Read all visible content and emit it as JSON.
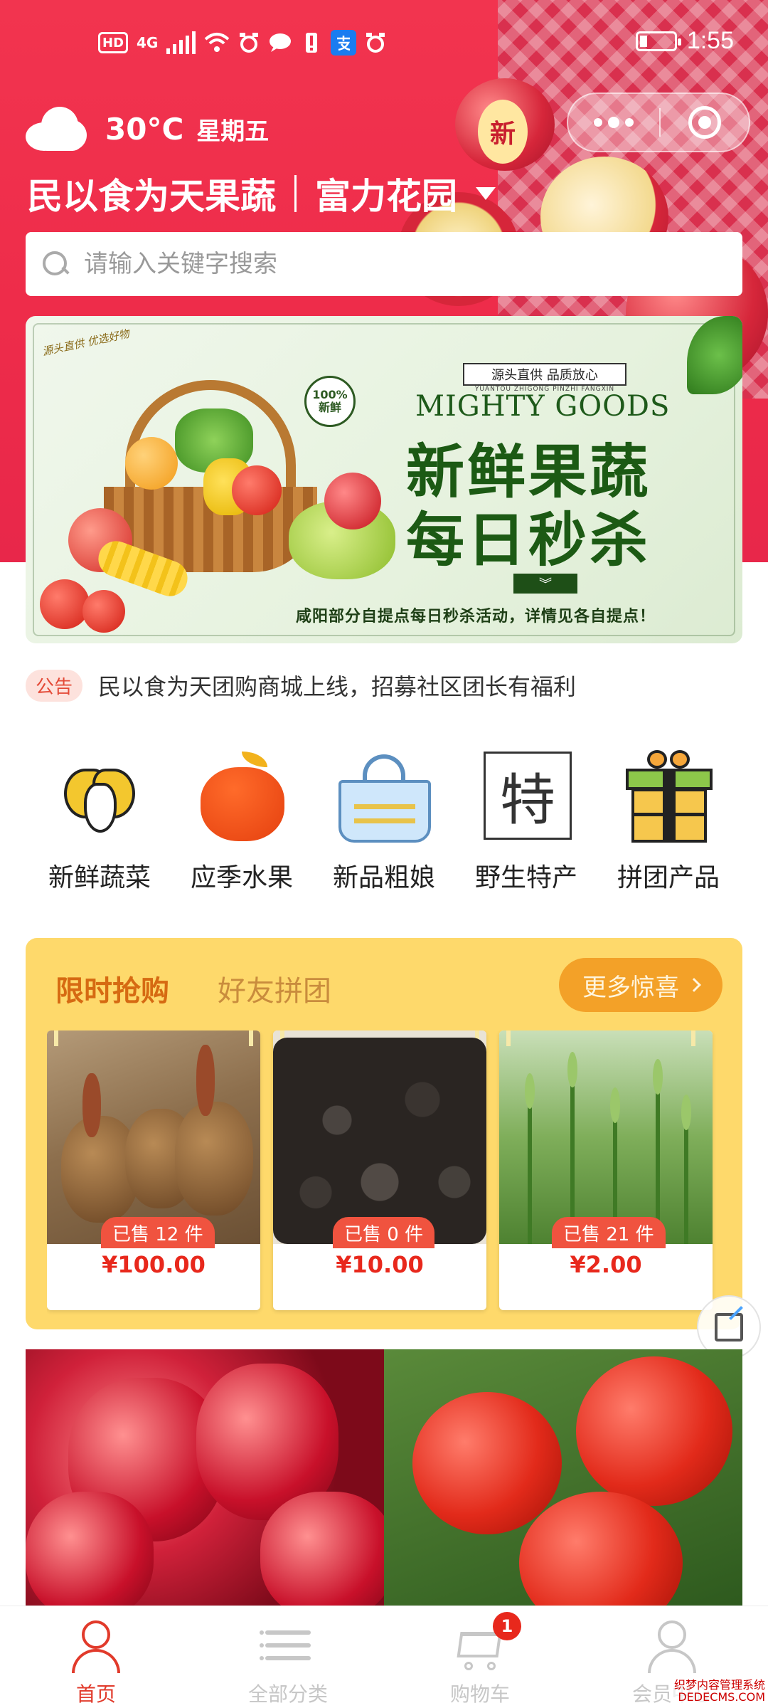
{
  "status_bar": {
    "hd": "HD",
    "network": "4G",
    "time": "1:55"
  },
  "header": {
    "temperature": "30°C",
    "weekday": "星期五",
    "shop_name": "民以食为天果蔬",
    "community": "富力花园",
    "hero_badge": "新"
  },
  "search": {
    "placeholder": "请输入关键字搜索"
  },
  "banner": {
    "tag": "源头直供 品质放心",
    "pinyin": "YUANTOU ZHIGONG PINZHI FANGXIN",
    "english": "MIGHTY GOODS",
    "line1": "新鲜果蔬",
    "line2": "每日秒杀",
    "footer": "咸阳部分自提点每日秒杀活动，详情见各自提点！",
    "stamp_top": "100%",
    "stamp_bottom": "新鲜",
    "side_text": "源头直供 优选好物",
    "chevron": "︾"
  },
  "notice": {
    "tag": "公告",
    "text": "民以食为天团购商城上线，招募社区团长有福利"
  },
  "categories": [
    {
      "label": "新鲜蔬菜",
      "icon": "vegetable-icon"
    },
    {
      "label": "应季水果",
      "icon": "apple-icon"
    },
    {
      "label": "新品粗娘",
      "icon": "basket-icon"
    },
    {
      "label": "野生特产",
      "icon": "specialty-icon"
    },
    {
      "label": "拼团产品",
      "icon": "gift-icon"
    }
  ],
  "flash_sale": {
    "tab_active": "限时抢购",
    "tab_inactive": "好友拼团",
    "more_label": "更多惊喜",
    "products": [
      {
        "sold": "已售 12 件",
        "price": "¥100.00",
        "image": "taro"
      },
      {
        "sold": "已售 0 件",
        "price": "¥10.00",
        "image": "black-fungus"
      },
      {
        "sold": "已售 21 件",
        "price": "¥2.00",
        "image": "wheat"
      }
    ]
  },
  "tabbar": {
    "items": [
      {
        "label": "首页",
        "active": true
      },
      {
        "label": "全部分类",
        "active": false
      },
      {
        "label": "购物车",
        "active": false,
        "badge": "1"
      },
      {
        "label": "会员中心",
        "active": false
      }
    ]
  },
  "watermark": {
    "line1": "织梦内容管理系统",
    "line2": "DEDECMS.COM"
  },
  "colors": {
    "brand_red": "#ee2c4a",
    "accent_orange": "#f3a128",
    "flash_bg": "#fed96b",
    "price_red": "#e8281c"
  }
}
